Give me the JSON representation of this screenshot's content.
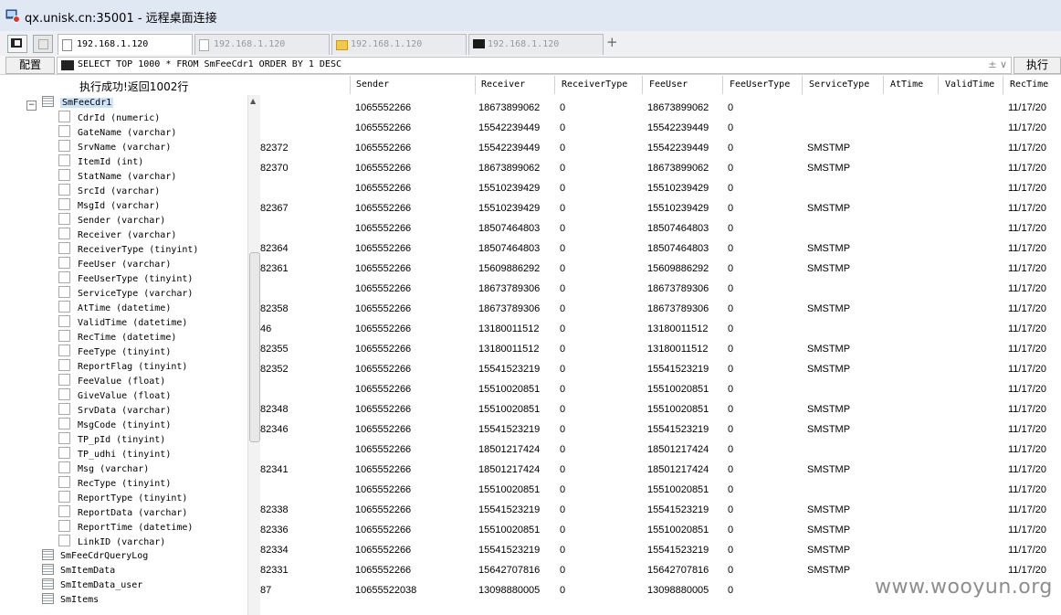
{
  "window": {
    "title": "qx.unisk.cn:35001 - 远程桌面连接"
  },
  "tabs": [
    {
      "label": "192.168.1.120",
      "icon": "page-icon",
      "active": true
    },
    {
      "label": "192.168.1.120",
      "icon": "page-icon",
      "active": false
    },
    {
      "label": "192.168.1.120",
      "icon": "folder-icon",
      "active": false
    },
    {
      "label": "192.168.1.120",
      "icon": "terminal-icon",
      "active": false
    }
  ],
  "add_tab": "+",
  "toolbar": {
    "config_label": "配置",
    "query": "SELECT TOP 1000 * FROM SmFeeCdr1 ORDER BY 1 DESC",
    "query_controls": "± ∨",
    "execute_label": "执行"
  },
  "status": "执行成功!返回1002行",
  "tree": {
    "root": "SmFeeCdr1",
    "columns": [
      "CdrId (numeric)",
      "GateName (varchar)",
      "SrvName (varchar)",
      "ItemId (int)",
      "StatName (varchar)",
      "SrcId (varchar)",
      "MsgId (varchar)",
      "Sender (varchar)",
      "Receiver (varchar)",
      "ReceiverType (tinyint)",
      "FeeUser (varchar)",
      "FeeUserType (tinyint)",
      "ServiceType (varchar)",
      "AtTime (datetime)",
      "ValidTime (datetime)",
      "RecTime (datetime)",
      "FeeType (tinyint)",
      "ReportFlag (tinyint)",
      "FeeValue (float)",
      "GiveValue (float)",
      "SrvData (varchar)",
      "MsgCode (tinyint)",
      "TP_pId (tinyint)",
      "TP_udhi (tinyint)",
      "Msg (varchar)",
      "RecType (tinyint)",
      "ReportType (tinyint)",
      "ReportData (varchar)",
      "ReportTime (datetime)",
      "LinkID (varchar)"
    ],
    "tables": [
      "SmFeeCdrQueryLog",
      "SmItemData",
      "SmItemData_user",
      "SmItems"
    ]
  },
  "grid": {
    "headers": [
      "Sender",
      "Receiver",
      "ReceiverType",
      "FeeUser",
      "FeeUserType",
      "ServiceType",
      "AtTime",
      "ValidTime",
      "RecTime"
    ],
    "rows": [
      {
        "lead": "",
        "sender": "1065552266",
        "receiver": "18673899062",
        "receiver_type": "0",
        "fee_user": "18673899062",
        "fee_user_type": "0",
        "service_type": "",
        "rec_time": "11/17/20"
      },
      {
        "lead": "",
        "sender": "1065552266",
        "receiver": "15542239449",
        "receiver_type": "0",
        "fee_user": "15542239449",
        "fee_user_type": "0",
        "service_type": "",
        "rec_time": "11/17/20"
      },
      {
        "lead": "82372",
        "sender": "1065552266",
        "receiver": "15542239449",
        "receiver_type": "0",
        "fee_user": "15542239449",
        "fee_user_type": "0",
        "service_type": "SMSTMP",
        "rec_time": "11/17/20"
      },
      {
        "lead": "82370",
        "sender": "1065552266",
        "receiver": "18673899062",
        "receiver_type": "0",
        "fee_user": "18673899062",
        "fee_user_type": "0",
        "service_type": "SMSTMP",
        "rec_time": "11/17/20"
      },
      {
        "lead": "",
        "sender": "1065552266",
        "receiver": "15510239429",
        "receiver_type": "0",
        "fee_user": "15510239429",
        "fee_user_type": "0",
        "service_type": "",
        "rec_time": "11/17/20"
      },
      {
        "lead": "82367",
        "sender": "1065552266",
        "receiver": "15510239429",
        "receiver_type": "0",
        "fee_user": "15510239429",
        "fee_user_type": "0",
        "service_type": "SMSTMP",
        "rec_time": "11/17/20"
      },
      {
        "lead": "",
        "sender": "1065552266",
        "receiver": "18507464803",
        "receiver_type": "0",
        "fee_user": "18507464803",
        "fee_user_type": "0",
        "service_type": "",
        "rec_time": "11/17/20"
      },
      {
        "lead": "82364",
        "sender": "1065552266",
        "receiver": "18507464803",
        "receiver_type": "0",
        "fee_user": "18507464803",
        "fee_user_type": "0",
        "service_type": "SMSTMP",
        "rec_time": "11/17/20"
      },
      {
        "lead": "82361",
        "sender": "1065552266",
        "receiver": "15609886292",
        "receiver_type": "0",
        "fee_user": "15609886292",
        "fee_user_type": "0",
        "service_type": "SMSTMP",
        "rec_time": "11/17/20"
      },
      {
        "lead": "",
        "sender": "1065552266",
        "receiver": "18673789306",
        "receiver_type": "0",
        "fee_user": "18673789306",
        "fee_user_type": "0",
        "service_type": "",
        "rec_time": "11/17/20"
      },
      {
        "lead": "82358",
        "sender": "1065552266",
        "receiver": "18673789306",
        "receiver_type": "0",
        "fee_user": "18673789306",
        "fee_user_type": "0",
        "service_type": "SMSTMP",
        "rec_time": "11/17/20"
      },
      {
        "lead": "46",
        "sender": "1065552266",
        "receiver": "13180011512",
        "receiver_type": "0",
        "fee_user": "13180011512",
        "fee_user_type": "0",
        "service_type": "",
        "rec_time": "11/17/20"
      },
      {
        "lead": "82355",
        "sender": "1065552266",
        "receiver": "13180011512",
        "receiver_type": "0",
        "fee_user": "13180011512",
        "fee_user_type": "0",
        "service_type": "SMSTMP",
        "rec_time": "11/17/20"
      },
      {
        "lead": "82352",
        "sender": "1065552266",
        "receiver": "15541523219",
        "receiver_type": "0",
        "fee_user": "15541523219",
        "fee_user_type": "0",
        "service_type": "SMSTMP",
        "rec_time": "11/17/20"
      },
      {
        "lead": "",
        "sender": "1065552266",
        "receiver": "15510020851",
        "receiver_type": "0",
        "fee_user": "15510020851",
        "fee_user_type": "0",
        "service_type": "",
        "rec_time": "11/17/20"
      },
      {
        "lead": "82348",
        "sender": "1065552266",
        "receiver": "15510020851",
        "receiver_type": "0",
        "fee_user": "15510020851",
        "fee_user_type": "0",
        "service_type": "SMSTMP",
        "rec_time": "11/17/20"
      },
      {
        "lead": "82346",
        "sender": "1065552266",
        "receiver": "15541523219",
        "receiver_type": "0",
        "fee_user": "15541523219",
        "fee_user_type": "0",
        "service_type": "SMSTMP",
        "rec_time": "11/17/20"
      },
      {
        "lead": "",
        "sender": "1065552266",
        "receiver": "18501217424",
        "receiver_type": "0",
        "fee_user": "18501217424",
        "fee_user_type": "0",
        "service_type": "",
        "rec_time": "11/17/20"
      },
      {
        "lead": "82341",
        "sender": "1065552266",
        "receiver": "18501217424",
        "receiver_type": "0",
        "fee_user": "18501217424",
        "fee_user_type": "0",
        "service_type": "SMSTMP",
        "rec_time": "11/17/20"
      },
      {
        "lead": "",
        "sender": "1065552266",
        "receiver": "15510020851",
        "receiver_type": "0",
        "fee_user": "15510020851",
        "fee_user_type": "0",
        "service_type": "",
        "rec_time": "11/17/20"
      },
      {
        "lead": "82338",
        "sender": "1065552266",
        "receiver": "15541523219",
        "receiver_type": "0",
        "fee_user": "15541523219",
        "fee_user_type": "0",
        "service_type": "SMSTMP",
        "rec_time": "11/17/20"
      },
      {
        "lead": "82336",
        "sender": "1065552266",
        "receiver": "15510020851",
        "receiver_type": "0",
        "fee_user": "15510020851",
        "fee_user_type": "0",
        "service_type": "SMSTMP",
        "rec_time": "11/17/20"
      },
      {
        "lead": "82334",
        "sender": "1065552266",
        "receiver": "15541523219",
        "receiver_type": "0",
        "fee_user": "15541523219",
        "fee_user_type": "0",
        "service_type": "SMSTMP",
        "rec_time": "11/17/20"
      },
      {
        "lead": "82331",
        "sender": "1065552266",
        "receiver": "15642707816",
        "receiver_type": "0",
        "fee_user": "15642707816",
        "fee_user_type": "0",
        "service_type": "SMSTMP",
        "rec_time": "11/17/20"
      },
      {
        "lead": "87",
        "sender": "10655522038",
        "receiver": "13098880005",
        "receiver_type": "0",
        "fee_user": "13098880005",
        "fee_user_type": "0",
        "service_type": "",
        "rec_time": ""
      }
    ]
  },
  "watermark": "www.wooyun.org"
}
